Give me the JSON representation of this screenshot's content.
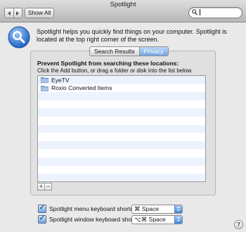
{
  "window": {
    "title": "Spotlight",
    "show_all_label": "Show All",
    "search": {
      "value": ""
    }
  },
  "header": {
    "description": "Spotlight helps you quickly find things on your computer. Spotlight is located at the top right corner of the screen."
  },
  "tabs": [
    {
      "label": "Search Results",
      "active": false
    },
    {
      "label": "Privacy",
      "active": true
    }
  ],
  "privacy": {
    "heading": "Prevent Spotlight from searching these locations:",
    "hint": "Click the Add button, or drag a folder or disk into the list below.",
    "items": [
      {
        "name": "EyeTV"
      },
      {
        "name": "Roxio Converted Items"
      }
    ],
    "add_label": "+",
    "remove_label": "−"
  },
  "shortcuts": {
    "menu": {
      "label": "Spotlight menu keyboard shortcut:",
      "checked": true,
      "value": "⌘ Space"
    },
    "window": {
      "label": "Spotlight window keyboard shortcut:",
      "checked": true,
      "value": "⌥⌘ Space"
    }
  },
  "help_label": "?",
  "colors": {
    "selected_tab": "#6fa6e2",
    "list_stripe": "#edf3fe",
    "checkbox": "#6aa0e0"
  }
}
